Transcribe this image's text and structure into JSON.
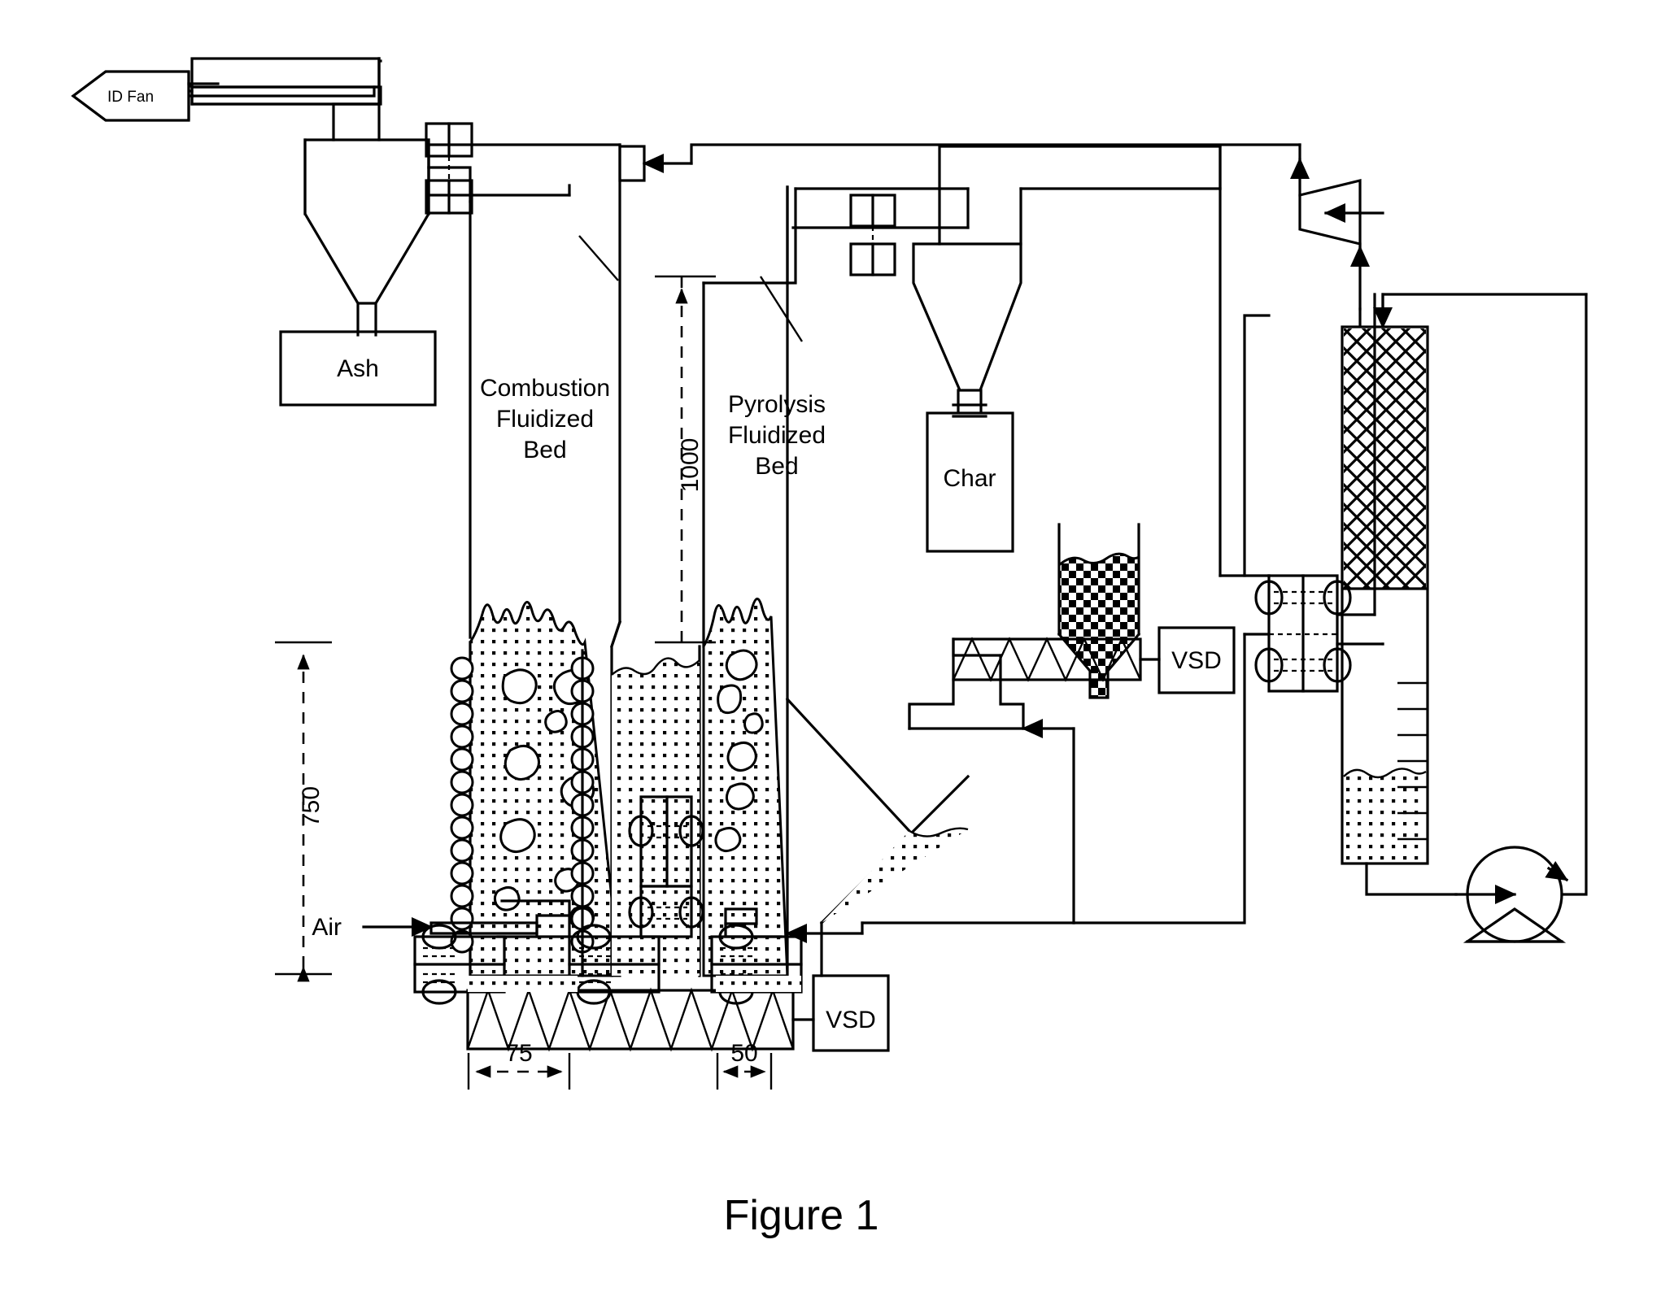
{
  "figure": {
    "caption": "Figure 1",
    "title": "Dual fluidized bed pyrolysis and combustion process flow diagram"
  },
  "labels": {
    "id_fan": "ID Fan",
    "ash": "Ash",
    "char": "Char",
    "combustion_bed": "Combustion\nFluidized\nBed",
    "combustion_bed_l1": "Combustion",
    "combustion_bed_l2": "Fluidized",
    "combustion_bed_l3": "Bed",
    "pyrolysis_bed_l1": "Pyrolysis",
    "pyrolysis_bed_l2": "Fluidized",
    "pyrolysis_bed_l3": "Bed",
    "air": "Air",
    "vsd_feed": "VSD",
    "vsd_bottom": "VSD"
  },
  "dimensions": {
    "height_1000": "1000",
    "height_750": "750",
    "width_75": "75",
    "width_50": "50"
  },
  "components": [
    {
      "name": "id-fan",
      "label": "ID Fan",
      "type": "fan"
    },
    {
      "name": "ash-cyclone",
      "label": "",
      "type": "cyclone"
    },
    {
      "name": "ash-collection-box",
      "label": "Ash",
      "type": "vessel"
    },
    {
      "name": "combustion-fluidized-bed",
      "label": "Combustion Fluidized Bed",
      "type": "reactor"
    },
    {
      "name": "pyrolysis-fluidized-bed",
      "label": "Pyrolysis Fluidized Bed",
      "type": "reactor"
    },
    {
      "name": "char-cyclone",
      "label": "",
      "type": "cyclone"
    },
    {
      "name": "char-collection-box",
      "label": "Char",
      "type": "vessel"
    },
    {
      "name": "biomass-feed-hopper",
      "label": "",
      "type": "hopper"
    },
    {
      "name": "feed-screw-conveyor",
      "label": "",
      "type": "screw-conveyor"
    },
    {
      "name": "feed-vsd",
      "label": "VSD",
      "type": "drive"
    },
    {
      "name": "bottom-screw-conveyor",
      "label": "",
      "type": "screw-conveyor"
    },
    {
      "name": "bottom-vsd",
      "label": "VSD",
      "type": "drive"
    },
    {
      "name": "heat-exchanger",
      "label": "",
      "type": "heat-exchanger"
    },
    {
      "name": "scrubber-column",
      "label": "",
      "type": "packed-column"
    },
    {
      "name": "recirculation-pump",
      "label": "",
      "type": "pump"
    },
    {
      "name": "blower",
      "label": "",
      "type": "blower"
    },
    {
      "name": "air-inlet",
      "label": "Air",
      "type": "stream"
    }
  ],
  "colors": {
    "line": "#000000",
    "background": "#ffffff",
    "fill": "#ffffff"
  }
}
